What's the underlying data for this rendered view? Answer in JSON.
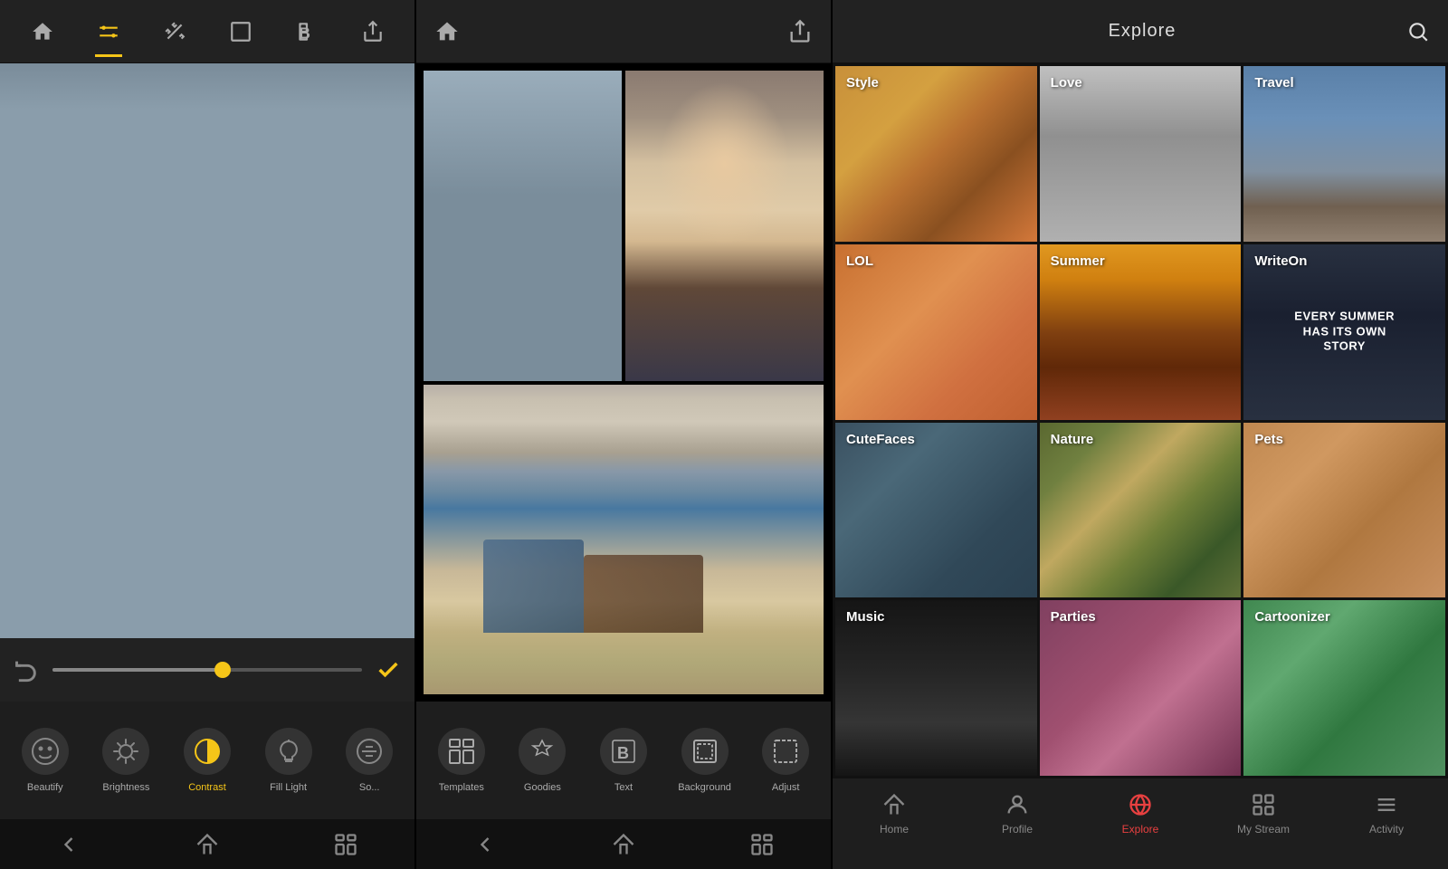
{
  "panel1": {
    "toolbar": {
      "home_icon": "⌂",
      "sliders_icon": "⊞",
      "wand_icon": "✦",
      "crop_icon": "▣",
      "bold_icon": "B",
      "share_icon": "↗"
    },
    "controls": {
      "undo_icon": "↩",
      "check_icon": "✓"
    },
    "tools": [
      {
        "label": "Beautify",
        "icon": "☺",
        "active": false
      },
      {
        "label": "Brightness",
        "icon": "☀",
        "active": false
      },
      {
        "label": "Contrast",
        "icon": "◑",
        "active": true
      },
      {
        "label": "Fill Light",
        "icon": "💡",
        "active": false
      },
      {
        "label": "So...",
        "icon": "↔",
        "active": false
      }
    ],
    "nav": [
      "←",
      "⌂",
      "▭"
    ]
  },
  "panel2": {
    "toolbar": {
      "home_icon": "⌂",
      "share_icon": "↗"
    },
    "tools": [
      {
        "label": "Templates",
        "icon": "⊞"
      },
      {
        "label": "Goodies",
        "icon": "◆"
      },
      {
        "label": "Text",
        "icon": "B"
      },
      {
        "label": "Background",
        "icon": "▣"
      },
      {
        "label": "Adjust",
        "icon": "⬚"
      }
    ],
    "nav": [
      "←",
      "⌂",
      "▭"
    ]
  },
  "panel3": {
    "toolbar": {
      "title": "Explore",
      "search_icon": "🔍"
    },
    "categories": [
      {
        "label": "Style",
        "bg_class": "bg-style"
      },
      {
        "label": "Love",
        "bg_class": "bg-love"
      },
      {
        "label": "Travel",
        "bg_class": "bg-travel"
      },
      {
        "label": "LOL",
        "bg_class": "bg-lol"
      },
      {
        "label": "Summer",
        "bg_class": "bg-summer"
      },
      {
        "label": "WriteOn",
        "bg_class": "bg-writeon",
        "sub_text": "EVERY SUMMER HAS ITS OWN STORY"
      },
      {
        "label": "CuteFaces",
        "bg_class": "bg-cutefaces"
      },
      {
        "label": "Nature",
        "bg_class": "bg-nature"
      },
      {
        "label": "Pets",
        "bg_class": "bg-pets"
      },
      {
        "label": "Music",
        "bg_class": "bg-music"
      },
      {
        "label": "Parties",
        "bg_class": "bg-parties"
      },
      {
        "label": "Cartoonizer",
        "bg_class": "bg-cartoonizer"
      }
    ],
    "nav_items": [
      {
        "label": "Home",
        "icon": "⌂",
        "active": false
      },
      {
        "label": "Profile",
        "icon": "👤",
        "active": false
      },
      {
        "label": "Explore",
        "icon": "🌐",
        "active": true
      },
      {
        "label": "My Stream",
        "icon": "⊞",
        "active": false
      },
      {
        "label": "Activity",
        "icon": "≡",
        "active": false
      }
    ]
  }
}
